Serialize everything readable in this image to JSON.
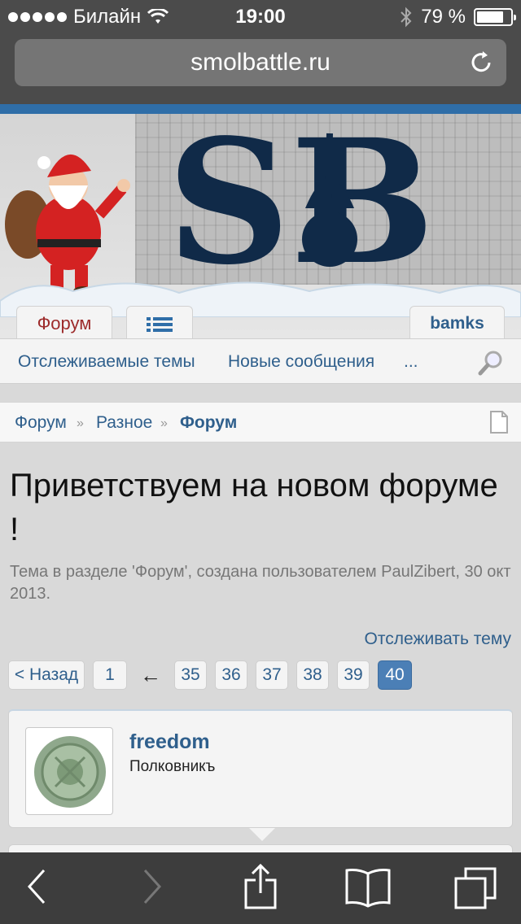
{
  "status": {
    "carrier": "Билайн",
    "time": "19:00",
    "battery_percent": "79 %",
    "battery_level": 0.79
  },
  "browser": {
    "url": "smolbattle.ru"
  },
  "header": {
    "logo": "SB",
    "tabs": {
      "forum": "Форум",
      "user": "bamks"
    }
  },
  "subnav": {
    "watched": "Отслеживаемые темы",
    "new_messages": "Новые сообщения",
    "more": "..."
  },
  "breadcrumb": {
    "items": [
      "Форум",
      "Разное",
      "Форум"
    ],
    "separator": "»"
  },
  "thread": {
    "title": "Приветствуем на новом форуме !",
    "meta": "Тема в разделе 'Форум', создана пользователем PaulZibert, 30 окт 2013.",
    "watch_label": "Отслеживать тему"
  },
  "pager": {
    "prev": "< Назад",
    "first": "1",
    "gap": "←",
    "pages": [
      "35",
      "36",
      "37",
      "38",
      "39",
      "40"
    ],
    "current": "40"
  },
  "post": {
    "username": "freedom",
    "user_title": "Полковникъ"
  },
  "colors": {
    "link": "#2f5f8c",
    "accent": "#2f6ea8",
    "active_page": "#4b7fb6"
  }
}
